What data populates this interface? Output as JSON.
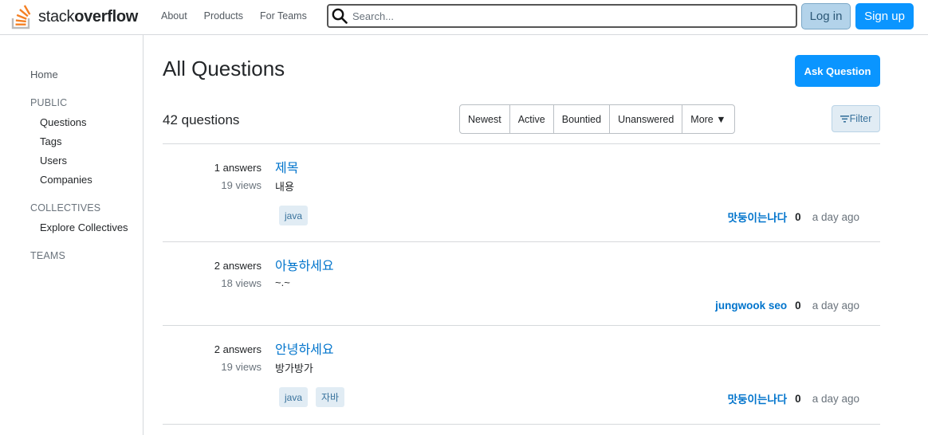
{
  "header": {
    "logo_light": "stack",
    "logo_bold": "overflow",
    "nav": [
      "About",
      "Products",
      "For Teams"
    ],
    "search_placeholder": "Search...",
    "login": "Log in",
    "signup": "Sign up",
    "accent": "#0a95ff"
  },
  "sidebar": {
    "home": "Home",
    "public": "PUBLIC",
    "questions": "Questions",
    "tags": "Tags",
    "users": "Users",
    "companies": "Companies",
    "collectives": "COLLECTIVES",
    "explore_collectives": "Explore Collectives",
    "teams": "TEAMS"
  },
  "main": {
    "title": "All Questions",
    "ask_button": "Ask Question",
    "count": "42 questions",
    "tabs": [
      "Newest",
      "Active",
      "Bountied",
      "Unanswered",
      "More ▼"
    ],
    "filter": "Filter",
    "questions": [
      {
        "answers": "1 answers",
        "views": "19 views",
        "title": "제목",
        "excerpt": "내용",
        "tags": [
          "java"
        ],
        "user": "맛둥이는나다",
        "rep": "0",
        "time": "a day ago"
      },
      {
        "answers": "2 answers",
        "views": "18 views",
        "title": "아뇽하세요",
        "excerpt": "~.~",
        "tags": [],
        "user": "jungwook seo",
        "rep": "0",
        "time": "a day ago"
      },
      {
        "answers": "2 answers",
        "views": "19 views",
        "title": "안녕하세요",
        "excerpt": "방가방가",
        "tags": [
          "java",
          "자바"
        ],
        "user": "맛둥이는나다",
        "rep": "0",
        "time": "a day ago"
      }
    ]
  }
}
